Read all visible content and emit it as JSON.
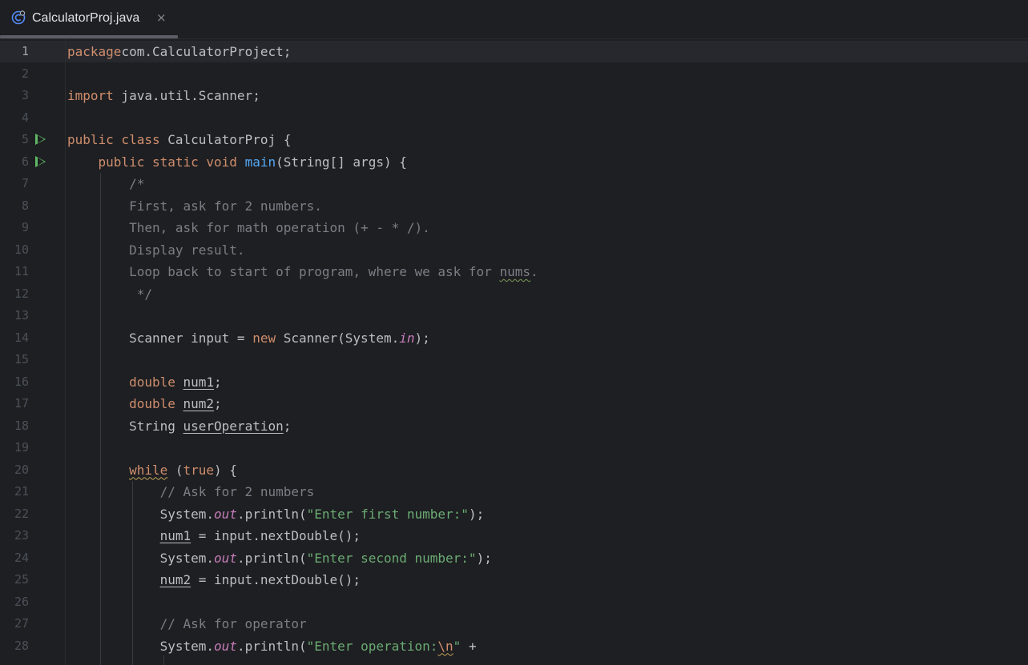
{
  "tab": {
    "title": "CalculatorProj.java",
    "close_glyph": "×",
    "icon": "java-class-icon"
  },
  "editor": {
    "current_line": 1,
    "lines": [
      {
        "n": "1",
        "run": false,
        "parts": [
          [
            "kw",
            "package"
          ],
          [
            "",
            "com.CalculatorProject;"
          ]
        ]
      },
      {
        "n": "2",
        "run": false,
        "parts": []
      },
      {
        "n": "3",
        "run": false,
        "parts": [
          [
            "kw",
            "import"
          ],
          [
            "",
            " java.util.Scanner;"
          ]
        ]
      },
      {
        "n": "4",
        "run": false,
        "parts": []
      },
      {
        "n": "5",
        "run": true,
        "parts": [
          [
            "kw",
            "public class"
          ],
          [
            "",
            " CalculatorProj {"
          ]
        ]
      },
      {
        "n": "6",
        "run": true,
        "parts": [
          [
            "",
            "    "
          ],
          [
            "kw",
            "public static void"
          ],
          [
            "",
            " "
          ],
          [
            "fn",
            "main"
          ],
          [
            "",
            "(String[] args) {"
          ]
        ]
      },
      {
        "n": "7",
        "run": false,
        "parts": [
          [
            "",
            "        "
          ],
          [
            "cm",
            "/*"
          ]
        ]
      },
      {
        "n": "8",
        "run": false,
        "parts": [
          [
            "",
            "        "
          ],
          [
            "cm",
            "First, ask for 2 numbers."
          ]
        ]
      },
      {
        "n": "9",
        "run": false,
        "parts": [
          [
            "",
            "        "
          ],
          [
            "cm",
            "Then, ask for math operation (+ - * /)."
          ]
        ]
      },
      {
        "n": "10",
        "run": false,
        "parts": [
          [
            "",
            "        "
          ],
          [
            "cm",
            "Display result."
          ]
        ]
      },
      {
        "n": "11",
        "run": false,
        "parts": [
          [
            "",
            "        "
          ],
          [
            "cm",
            "Loop back to start of program, where we ask for "
          ],
          [
            "cm sqg",
            "nums"
          ],
          [
            "cm",
            "."
          ]
        ]
      },
      {
        "n": "12",
        "run": false,
        "parts": [
          [
            "",
            "         "
          ],
          [
            "cm",
            "*/"
          ]
        ]
      },
      {
        "n": "13",
        "run": false,
        "parts": []
      },
      {
        "n": "14",
        "run": false,
        "parts": [
          [
            "",
            "        Scanner input = "
          ],
          [
            "kw",
            "new"
          ],
          [
            "",
            " Scanner(System."
          ],
          [
            "st",
            "in"
          ],
          [
            "",
            ");"
          ]
        ]
      },
      {
        "n": "15",
        "run": false,
        "parts": []
      },
      {
        "n": "16",
        "run": false,
        "parts": [
          [
            "",
            "        "
          ],
          [
            "kw",
            "double"
          ],
          [
            "",
            " "
          ],
          [
            "ul",
            "num1"
          ],
          [
            "",
            ";"
          ]
        ]
      },
      {
        "n": "17",
        "run": false,
        "parts": [
          [
            "",
            "        "
          ],
          [
            "kw",
            "double"
          ],
          [
            "",
            " "
          ],
          [
            "ul",
            "num2"
          ],
          [
            "",
            ";"
          ]
        ]
      },
      {
        "n": "18",
        "run": false,
        "parts": [
          [
            "",
            "        String "
          ],
          [
            "ul",
            "userOperation"
          ],
          [
            "",
            ";"
          ]
        ]
      },
      {
        "n": "19",
        "run": false,
        "parts": []
      },
      {
        "n": "20",
        "run": false,
        "parts": [
          [
            "",
            "        "
          ],
          [
            "kw sq",
            "while"
          ],
          [
            "",
            " ("
          ],
          [
            "kw",
            "true"
          ],
          [
            "",
            ") {"
          ]
        ]
      },
      {
        "n": "21",
        "run": false,
        "parts": [
          [
            "",
            "            "
          ],
          [
            "cm",
            "// Ask for 2 numbers"
          ]
        ]
      },
      {
        "n": "22",
        "run": false,
        "parts": [
          [
            "",
            "            System."
          ],
          [
            "st",
            "out"
          ],
          [
            "",
            ".println("
          ],
          [
            "str",
            "\"Enter first number:\""
          ],
          [
            "",
            ");"
          ]
        ]
      },
      {
        "n": "23",
        "run": false,
        "parts": [
          [
            "",
            "            "
          ],
          [
            "ul",
            "num1"
          ],
          [
            "",
            " = input.nextDouble();"
          ]
        ]
      },
      {
        "n": "24",
        "run": false,
        "parts": [
          [
            "",
            "            System."
          ],
          [
            "st",
            "out"
          ],
          [
            "",
            ".println("
          ],
          [
            "str",
            "\"Enter second number:\""
          ],
          [
            "",
            ");"
          ]
        ]
      },
      {
        "n": "25",
        "run": false,
        "parts": [
          [
            "",
            "            "
          ],
          [
            "ul",
            "num2"
          ],
          [
            "",
            " = input.nextDouble();"
          ]
        ]
      },
      {
        "n": "26",
        "run": false,
        "parts": []
      },
      {
        "n": "27",
        "run": false,
        "parts": [
          [
            "",
            "            "
          ],
          [
            "cm",
            "// Ask for operator"
          ]
        ]
      },
      {
        "n": "28",
        "run": false,
        "parts": [
          [
            "",
            "            System."
          ],
          [
            "st",
            "out"
          ],
          [
            "",
            ".println("
          ],
          [
            "str",
            "\"Enter operation:"
          ],
          [
            "kw sq",
            "\\n"
          ],
          [
            "str",
            "\""
          ],
          [
            "",
            " +"
          ]
        ]
      }
    ]
  }
}
